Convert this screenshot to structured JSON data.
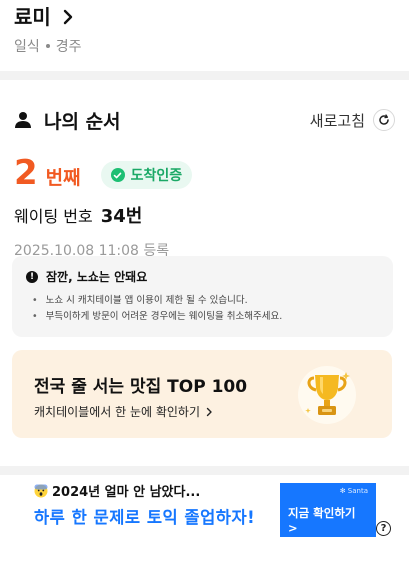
{
  "store": {
    "name": "료미",
    "category": "일식",
    "location": "경주"
  },
  "queue": {
    "title": "나의 순서",
    "refresh_label": "새로고침",
    "order_number": "2",
    "order_unit": "번째",
    "badge_label": "도착인증",
    "waiting_label": "웨이팅 번호",
    "waiting_number": "34번",
    "registered_at": "2025.10.08 11:08 등록"
  },
  "notice": {
    "title": "잠깐, 노쇼는 안돼요",
    "items": [
      "노쇼 시 캐치테이블 앱 이용이 제한 될 수 있습니다.",
      "부득이하게 방문이 어려운 경우에는 웨이팅을 취소해주세요."
    ]
  },
  "promo": {
    "title": "전국 줄 서는 맛집 TOP 100",
    "subtitle": "캐치테이블에서 한 눈에 확인하기"
  },
  "ad": {
    "line1": "2024년 얼마 안 남았다...",
    "line2": "하루 한 문제로 토익 졸업하자!",
    "brand": "Santa",
    "button_label": "지금 확인하기 >",
    "info_icon": "?"
  },
  "colors": {
    "accent_orange": "#f15a22",
    "badge_green": "#1dbf73",
    "ad_blue": "#1677ff",
    "promo_bg": "#fdf1e1"
  }
}
